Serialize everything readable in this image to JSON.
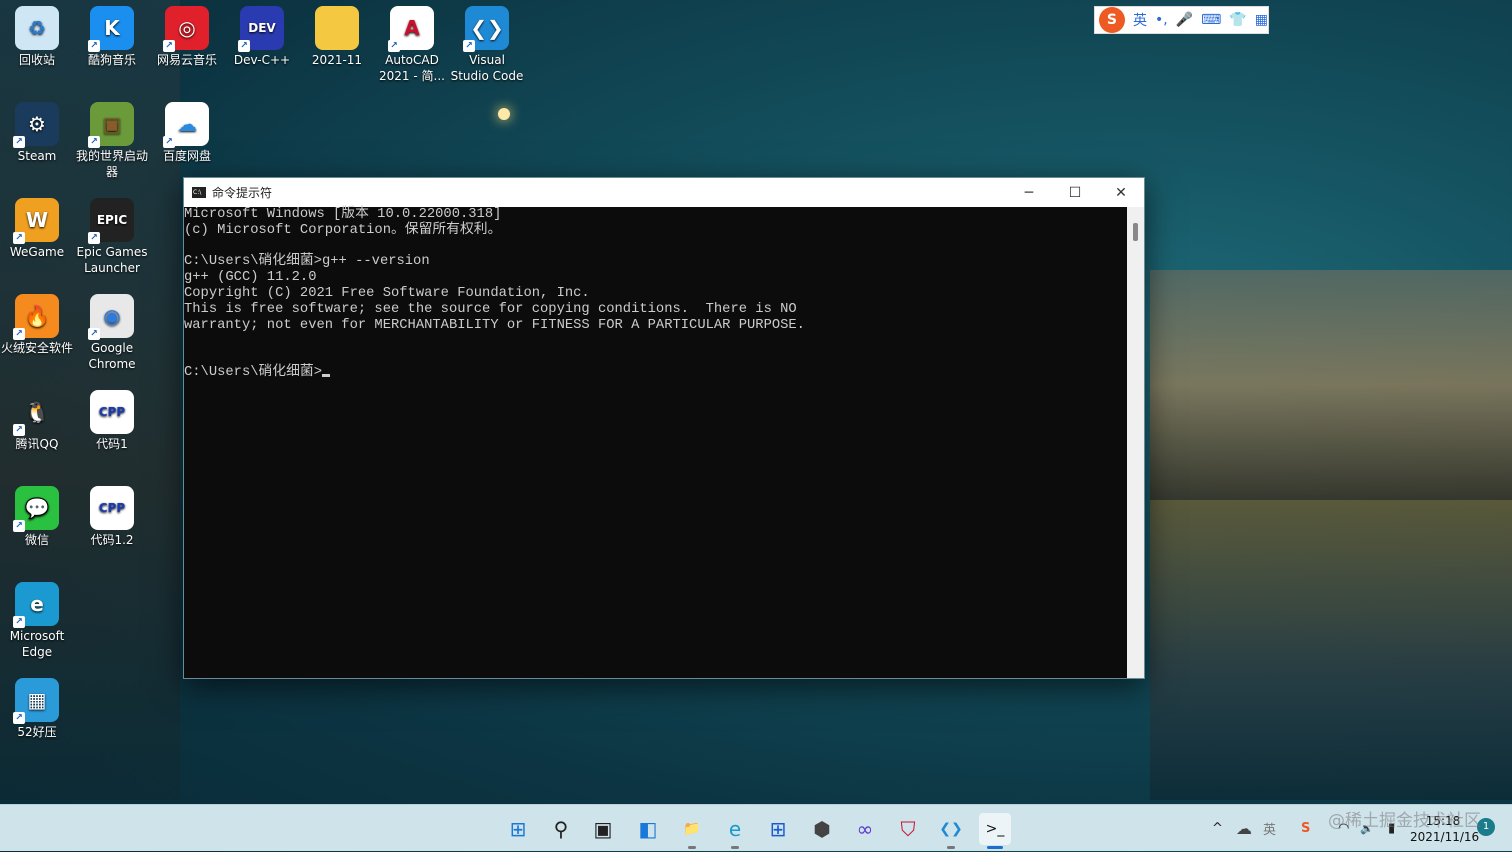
{
  "desktop": {
    "icons": [
      {
        "label": "回收站",
        "glyph": "♻",
        "bg": "#cfe6f5",
        "fg": "#2a7ad0",
        "icon": "recycle-bin-icon",
        "col": 0,
        "row": 0,
        "shortcut": false
      },
      {
        "label": "酷狗音乐",
        "glyph": "K",
        "bg": "#1a8ff0",
        "fg": "#fff",
        "icon": "kugou-icon",
        "col": 1,
        "row": 0,
        "shortcut": true
      },
      {
        "label": "网易云音乐",
        "glyph": "◎",
        "bg": "#e0202a",
        "fg": "#fff",
        "icon": "netease-music-icon",
        "col": 2,
        "row": 0,
        "shortcut": true
      },
      {
        "label": "Dev-C++",
        "glyph": "DEV",
        "bg": "#2a3ab0",
        "fg": "#fff",
        "icon": "devcpp-icon",
        "col": 3,
        "row": 0,
        "shortcut": true
      },
      {
        "label": "2021-11",
        "glyph": "",
        "bg": "#f5c842",
        "fg": "#fff",
        "icon": "folder-icon",
        "col": 4,
        "row": 0,
        "shortcut": false
      },
      {
        "label": "AutoCAD 2021 - 简...",
        "glyph": "A",
        "bg": "#fff",
        "fg": "#c8102e",
        "icon": "autocad-icon",
        "col": 5,
        "row": 0,
        "shortcut": true
      },
      {
        "label": "Visual Studio Code",
        "glyph": "❮❯",
        "bg": "#1e8ad6",
        "fg": "#fff",
        "icon": "vscode-icon",
        "col": 6,
        "row": 0,
        "shortcut": true
      },
      {
        "label": "Steam",
        "glyph": "⚙",
        "bg": "#1b3b5c",
        "fg": "#fff",
        "icon": "steam-icon",
        "col": 0,
        "row": 1,
        "shortcut": true
      },
      {
        "label": "我的世界启动器",
        "glyph": "▣",
        "bg": "#6a9a3a",
        "fg": "#8a5a2a",
        "icon": "minecraft-launcher-icon",
        "col": 1,
        "row": 1,
        "shortcut": true
      },
      {
        "label": "百度网盘",
        "glyph": "☁",
        "bg": "#fff",
        "fg": "#2a8ae0",
        "icon": "baidu-netdisk-icon",
        "col": 2,
        "row": 1,
        "shortcut": true
      },
      {
        "label": "WeGame",
        "glyph": "W",
        "bg": "#f0a020",
        "fg": "#fff",
        "icon": "wegame-icon",
        "col": 0,
        "row": 2,
        "shortcut": true
      },
      {
        "label": "Epic Games Launcher",
        "glyph": "EPIC",
        "bg": "#222",
        "fg": "#fff",
        "icon": "epic-games-icon",
        "col": 1,
        "row": 2,
        "shortcut": true
      },
      {
        "label": "火绒安全软件",
        "glyph": "🔥",
        "bg": "#f58a1f",
        "fg": "#fff",
        "icon": "huorong-icon",
        "col": 0,
        "row": 3,
        "shortcut": true
      },
      {
        "label": "Google Chrome",
        "glyph": "◉",
        "bg": "#e8e8e8",
        "fg": "#2a7ae0",
        "icon": "chrome-icon",
        "col": 1,
        "row": 3,
        "shortcut": true
      },
      {
        "label": "腾讯QQ",
        "glyph": "🐧",
        "bg": "transparent",
        "fg": "#000",
        "icon": "qq-icon",
        "col": 0,
        "row": 4,
        "shortcut": true
      },
      {
        "label": "代码1",
        "glyph": "CPP",
        "bg": "#fff",
        "fg": "#1a3ab0",
        "icon": "cpp-file-icon",
        "col": 1,
        "row": 4,
        "shortcut": false
      },
      {
        "label": "微信",
        "glyph": "💬",
        "bg": "#2ac040",
        "fg": "#fff",
        "icon": "wechat-icon",
        "col": 0,
        "row": 5,
        "shortcut": true
      },
      {
        "label": "代码1.2",
        "glyph": "CPP",
        "bg": "#fff",
        "fg": "#1a3ab0",
        "icon": "cpp-file-icon",
        "col": 1,
        "row": 5,
        "shortcut": false
      },
      {
        "label": "Microsoft Edge",
        "glyph": "e",
        "bg": "#1a9ad0",
        "fg": "#fff",
        "icon": "edge-icon",
        "col": 0,
        "row": 6,
        "shortcut": true
      },
      {
        "label": "52好压",
        "glyph": "▦",
        "bg": "#2a9ad8",
        "fg": "#fff",
        "icon": "haozip-icon",
        "col": 0,
        "row": 7,
        "shortcut": true
      }
    ]
  },
  "ime": {
    "logo": "S",
    "mode": "英",
    "items": [
      "•,",
      "🎤",
      "⌨",
      "👕",
      "▦"
    ]
  },
  "window": {
    "title": "命令提示符",
    "minimize": "─",
    "maximize": "☐",
    "close": "✕",
    "lines": [
      "Microsoft Windows [版本 10.0.22000.318]",
      "(c) Microsoft Corporation。保留所有权利。",
      "",
      "C:\\Users\\硝化细菌>g++ --version",
      "g++ (GCC) 11.2.0",
      "Copyright (C) 2021 Free Software Foundation, Inc.",
      "This is free software; see the source for copying conditions.  There is NO",
      "warranty; not even for MERCHANTABILITY or FITNESS FOR A PARTICULAR PURPOSE.",
      "",
      "",
      "C:\\Users\\硝化细菌>"
    ]
  },
  "taskbar": {
    "apps": [
      {
        "name": "start",
        "glyph": "⊞",
        "color": "#1a78d8",
        "active": false,
        "running": false
      },
      {
        "name": "search",
        "glyph": "⚲",
        "color": "#222",
        "active": false,
        "running": false
      },
      {
        "name": "task-view",
        "glyph": "▣",
        "color": "#222",
        "active": false,
        "running": false
      },
      {
        "name": "widgets",
        "glyph": "◧",
        "color": "#1a78d8",
        "active": false,
        "running": false
      },
      {
        "name": "file-explorer",
        "glyph": "📁",
        "color": "#e8b020",
        "active": false,
        "running": true
      },
      {
        "name": "edge",
        "glyph": "e",
        "color": "#1a9ad0",
        "active": false,
        "running": true
      },
      {
        "name": "microsoft-store",
        "glyph": "⊞",
        "color": "#1a5ad0",
        "active": false,
        "running": false
      },
      {
        "name": "unity",
        "glyph": "⬢",
        "color": "#444",
        "active": false,
        "running": false
      },
      {
        "name": "visual-studio",
        "glyph": "∞",
        "color": "#5a3ad0",
        "active": false,
        "running": false
      },
      {
        "name": "mcafee",
        "glyph": "⛉",
        "color": "#c8102e",
        "active": false,
        "running": false
      },
      {
        "name": "vscode",
        "glyph": "❮❯",
        "color": "#1e8ad6",
        "active": false,
        "running": true
      },
      {
        "name": "command-prompt",
        "glyph": ">_",
        "color": "#111",
        "active": true,
        "running": true
      }
    ],
    "tray": {
      "chevron": "^",
      "onedrive": "☁",
      "ime": "英",
      "sogou": "S",
      "wifi": "◠",
      "volume": "🔈",
      "battery": "▮"
    },
    "time": "15:18",
    "date": "2021/11/16",
    "notifications": "1",
    "watermark": "@稀土掘金技术社区"
  }
}
